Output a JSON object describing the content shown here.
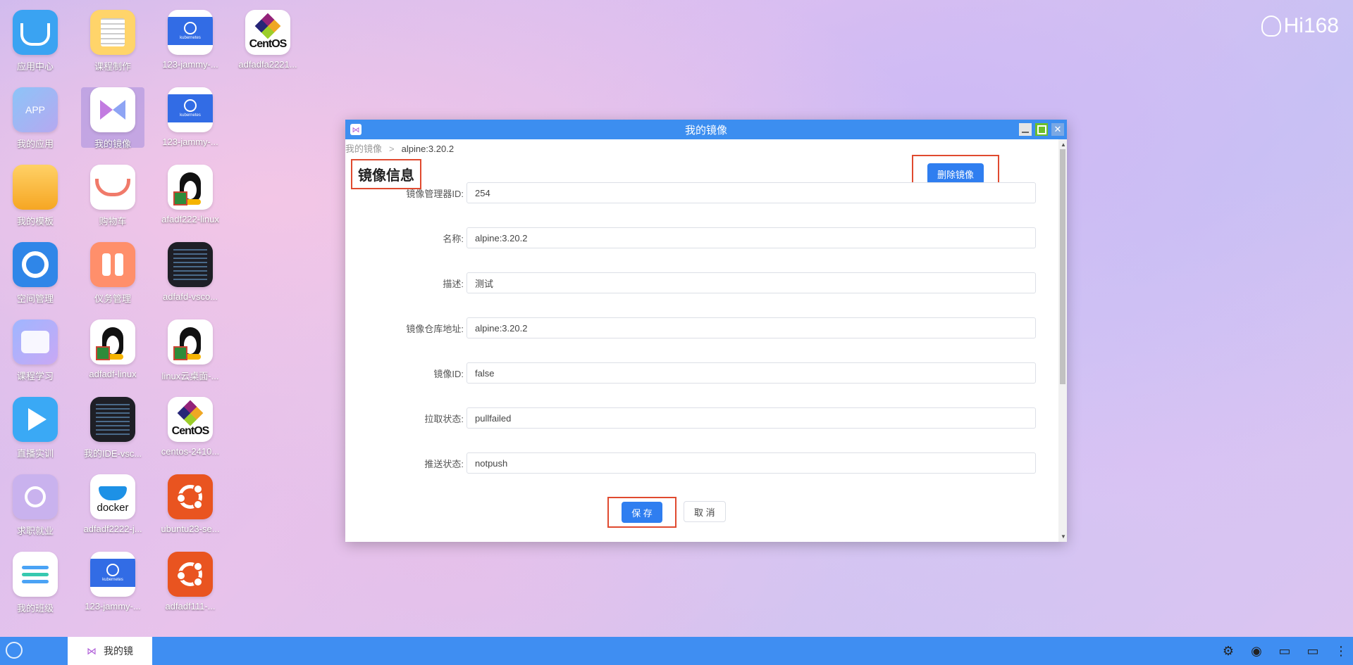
{
  "desktop": {
    "icons": [
      {
        "label": "应用中心"
      },
      {
        "label": "课程制作"
      },
      {
        "label": "123-jammy-..."
      },
      {
        "label": "adfadfa2221..."
      },
      {
        "label": "我的应用"
      },
      {
        "label": "我的镜像"
      },
      {
        "label": "123-jammy-..."
      },
      {
        "label": "我的模板"
      },
      {
        "label": "购物车"
      },
      {
        "label": "afadf222-linux"
      },
      {
        "label": "空间管理"
      },
      {
        "label": "仪务管理"
      },
      {
        "label": "adfafd-vsco..."
      },
      {
        "label": "课程学习"
      },
      {
        "label": "adfadf-linux"
      },
      {
        "label": "linux云桌面-..."
      },
      {
        "label": "直播实训"
      },
      {
        "label": "我的IDE-vsc..."
      },
      {
        "label": "centos-2410..."
      },
      {
        "label": "求职就业"
      },
      {
        "label": "adfadf2222-j..."
      },
      {
        "label": "ubuntu23-se..."
      },
      {
        "label": "我的班级"
      },
      {
        "label": "123-jammy-..."
      },
      {
        "label": "adfadf111-..."
      }
    ],
    "app_badge_text": "APP",
    "k8s_text": "kubernetes",
    "centos_text": "CentOS",
    "docker_text": "docker",
    "brand": "Hi168"
  },
  "window": {
    "title": "我的镜像",
    "breadcrumb": {
      "root": "我的镜像",
      "separator": ">",
      "current": "alpine:3.20.2"
    },
    "section_title": "镜像信息",
    "delete_label": "删除镜像",
    "fields": [
      {
        "label": "镜像管理器ID:",
        "value": "254"
      },
      {
        "label": "名称:",
        "value": "alpine:3.20.2"
      },
      {
        "label": "描述:",
        "value": "测试"
      },
      {
        "label": "镜像仓库地址:",
        "value": "alpine:3.20.2"
      },
      {
        "label": "镜像ID:",
        "value": "false"
      },
      {
        "label": "拉取状态:",
        "value": "pullfailed"
      },
      {
        "label": "推送状态:",
        "value": "notpush"
      }
    ],
    "save_label": "保 存",
    "cancel_label": "取 消"
  },
  "taskbar": {
    "active_item": "我的镜",
    "tray_icons": [
      "settings-icon",
      "wechat-icon",
      "chat-icon",
      "monitor-icon",
      "more-icon"
    ]
  },
  "colors": {
    "accent": "#3c8ef0",
    "primary_button": "#2f7ef0",
    "highlight_border": "#e04a2f"
  }
}
